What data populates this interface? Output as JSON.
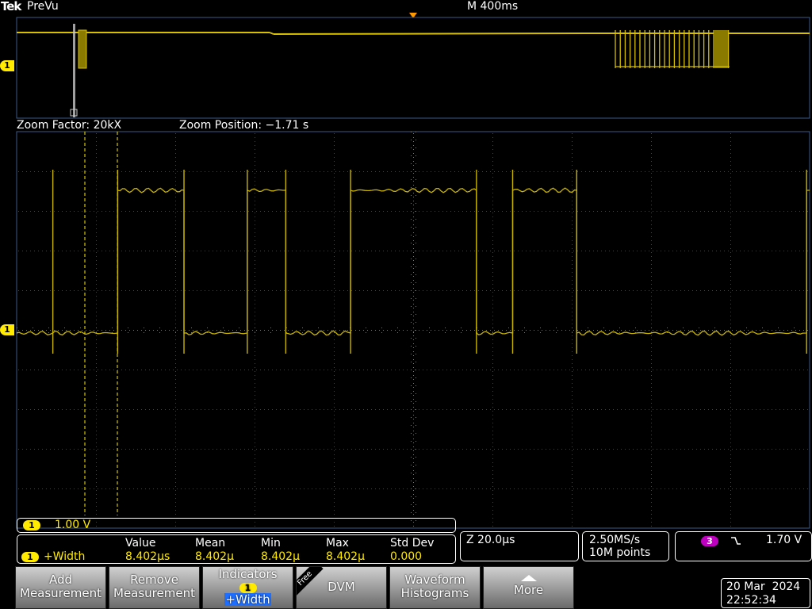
{
  "header": {
    "brand": "Tek",
    "mode": "PreVu",
    "timebase": "M 400ms"
  },
  "zoom": {
    "factor_label": "Zoom Factor: 20kX",
    "position_label": "Zoom Position: −1.71 s"
  },
  "channel": {
    "number": "1",
    "scale": "1.00 V",
    "color": "#ffea00"
  },
  "measurement": {
    "label": "+Width",
    "columns": [
      "Value",
      "Mean",
      "Min",
      "Max",
      "Std Dev"
    ],
    "values": [
      "8.402µs",
      "8.402µ",
      "8.402µ",
      "8.402µ",
      "0.000"
    ]
  },
  "status": {
    "zoom_scale": "Z 20.0µs",
    "sample_rate": "2.50MS/s",
    "record_length": "10M points",
    "trigger_channel": "3",
    "trigger_slope_icon": "falling-edge-icon",
    "trigger_level": "1.70 V"
  },
  "softkeys": [
    {
      "line1": "Add",
      "line2": "Measurement"
    },
    {
      "line1": "Remove",
      "line2": "Measurement"
    },
    {
      "line1": "Indicators",
      "badge": "1",
      "line2": "+Width"
    },
    {
      "tag": "Free",
      "line1": "DVM"
    },
    {
      "line1": "Waveform",
      "line2": "Histograms"
    },
    {
      "line1": "More",
      "icon": "triangle-up-icon"
    }
  ],
  "datetime": {
    "date": "20 Mar  2024",
    "time": "22:52:34"
  },
  "chart_data": {
    "type": "line",
    "title": "",
    "xlabel": "",
    "ylabel": "",
    "series": [
      {
        "x_us": [
          0,
          8.6,
          17.4,
          25.8,
          30.9,
          39.5,
          56.2,
          61.0,
          69.5,
          100.0
        ],
        "level": [
          "low",
          "high",
          "low",
          "high",
          "low",
          "high",
          "low",
          "high",
          "low",
          "high"
        ]
      }
    ],
    "x_range_us": [
      -4.8,
      100.4
    ],
    "grid": true
  }
}
